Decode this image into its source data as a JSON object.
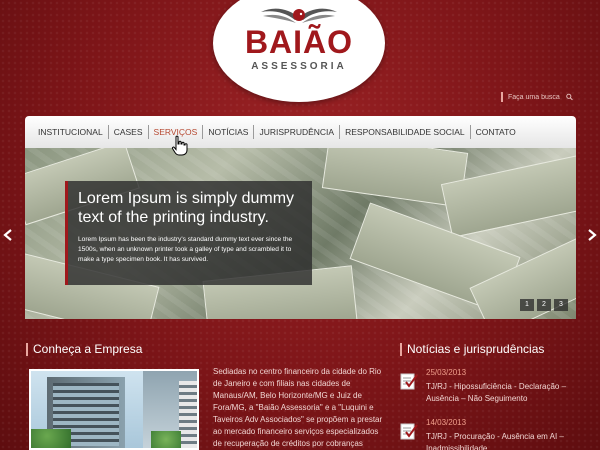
{
  "brand": {
    "name": "BAIÃO",
    "tagline": "ASSESSORIA"
  },
  "search": {
    "placeholder": "Faça uma busca"
  },
  "nav": {
    "items": [
      "INSTITUCIONAL",
      "CASES",
      "SERVIÇOS",
      "NOTÍCIAS",
      "JURISPRUDÊNCIA",
      "RESPONSABILIDADE SOCIAL",
      "CONTATO"
    ],
    "active": "SERVIÇOS"
  },
  "slider": {
    "title": "Lorem Ipsum is simply dummy text of the printing industry.",
    "text": "Lorem Ipsum has been the industry's standard dummy text ever since the 1500s, when an unknown printer took a galley of type and scrambled it to make a type specimen book. It has survived.",
    "pages": [
      "1",
      "2",
      "3"
    ]
  },
  "company": {
    "heading": "Conheça a Empresa",
    "text": "Sediadas no centro financeiro da cidade do Rio de Janeiro e com filiais nas cidades de Manaus/AM, Belo Horizonte/MG e Juiz de Fora/MG, a \"Baião Assessoria\" e a \"Luquini e Taveiros Adv Associados\" se propõem a prestar ao mercado financeiro serviços especializados de recuperação de créditos por cobranças"
  },
  "news": {
    "heading": "Notícias e jurisprudências",
    "items": [
      {
        "date": "25/03/2013",
        "text": "TJ/RJ - Hipossuficiência - Declaração – Ausência – Não Seguimento"
      },
      {
        "date": "14/03/2013",
        "text": "TJ/RJ - Procuração - Ausência em AI – Inadmissibilidade"
      }
    ]
  },
  "colors": {
    "brand": "#a0181c",
    "background": "#7a1416",
    "accent": "#ef9d8a"
  }
}
